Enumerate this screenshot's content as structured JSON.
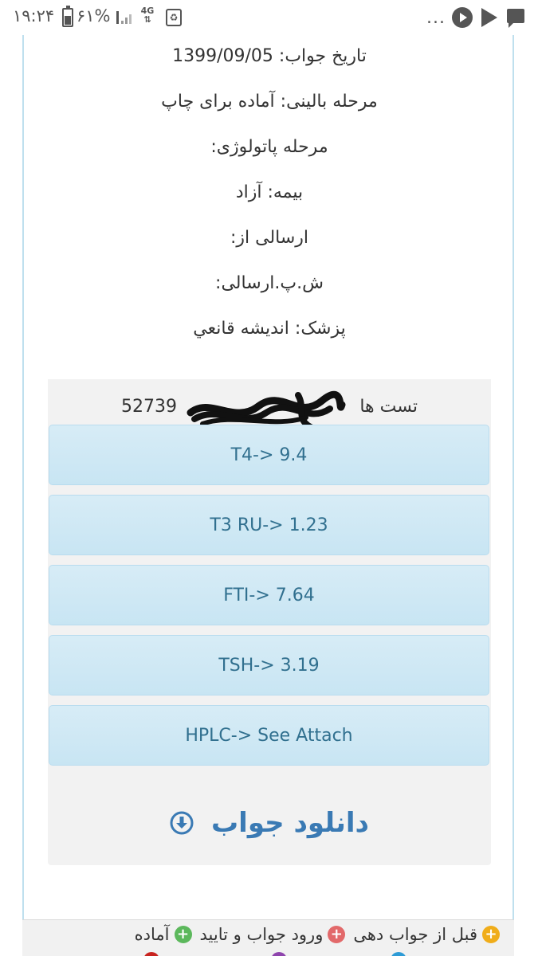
{
  "status_bar": {
    "time": "۱۹:۲۴",
    "battery_percent_text": "۶۱%",
    "battery_level": 0.61,
    "network": "4G",
    "overflow": "..."
  },
  "info": {
    "answer_date": "تاریخ جواب: 1399/09/05",
    "clinical_stage": "مرحله بالینی: آماده برای چاپ",
    "pathology_stage": "مرحله پاتولوژی:",
    "insurance": "بیمه: آزاد",
    "sent_from": "ارسالی از:",
    "sent_code": "ش.پ.ارسالی:",
    "doctor": "پزشک: اندیشه قانعي"
  },
  "tests_header": {
    "label": "تست ها",
    "number": "52739"
  },
  "tests": [
    {
      "label": "T4-> 9.4"
    },
    {
      "label": "T3 RU-> 1.23"
    },
    {
      "label": "FTI-> 7.64"
    },
    {
      "label": "TSH-> 3.19"
    },
    {
      "label": "HPLC-> See Attach"
    }
  ],
  "download": {
    "label": "دانلود جواب",
    "icon": "download-circle-icon",
    "color": "#3a7ab4"
  },
  "legend": {
    "items": [
      {
        "label": "قبل از جواب دهی",
        "icon": "plus-orange-icon",
        "color": "#f0ad1a"
      },
      {
        "label": "ورود جواب و تایید",
        "icon": "plus-red-icon",
        "color": "#e2696a"
      },
      {
        "label": "آماده",
        "icon": "plus-green-icon",
        "color": "#5cb85c"
      }
    ]
  },
  "colors": {
    "button_bg": "#d7ecf6",
    "button_text": "#31708f",
    "panel_bg": "#f2f2f2",
    "frame": "#bfe0ee"
  }
}
